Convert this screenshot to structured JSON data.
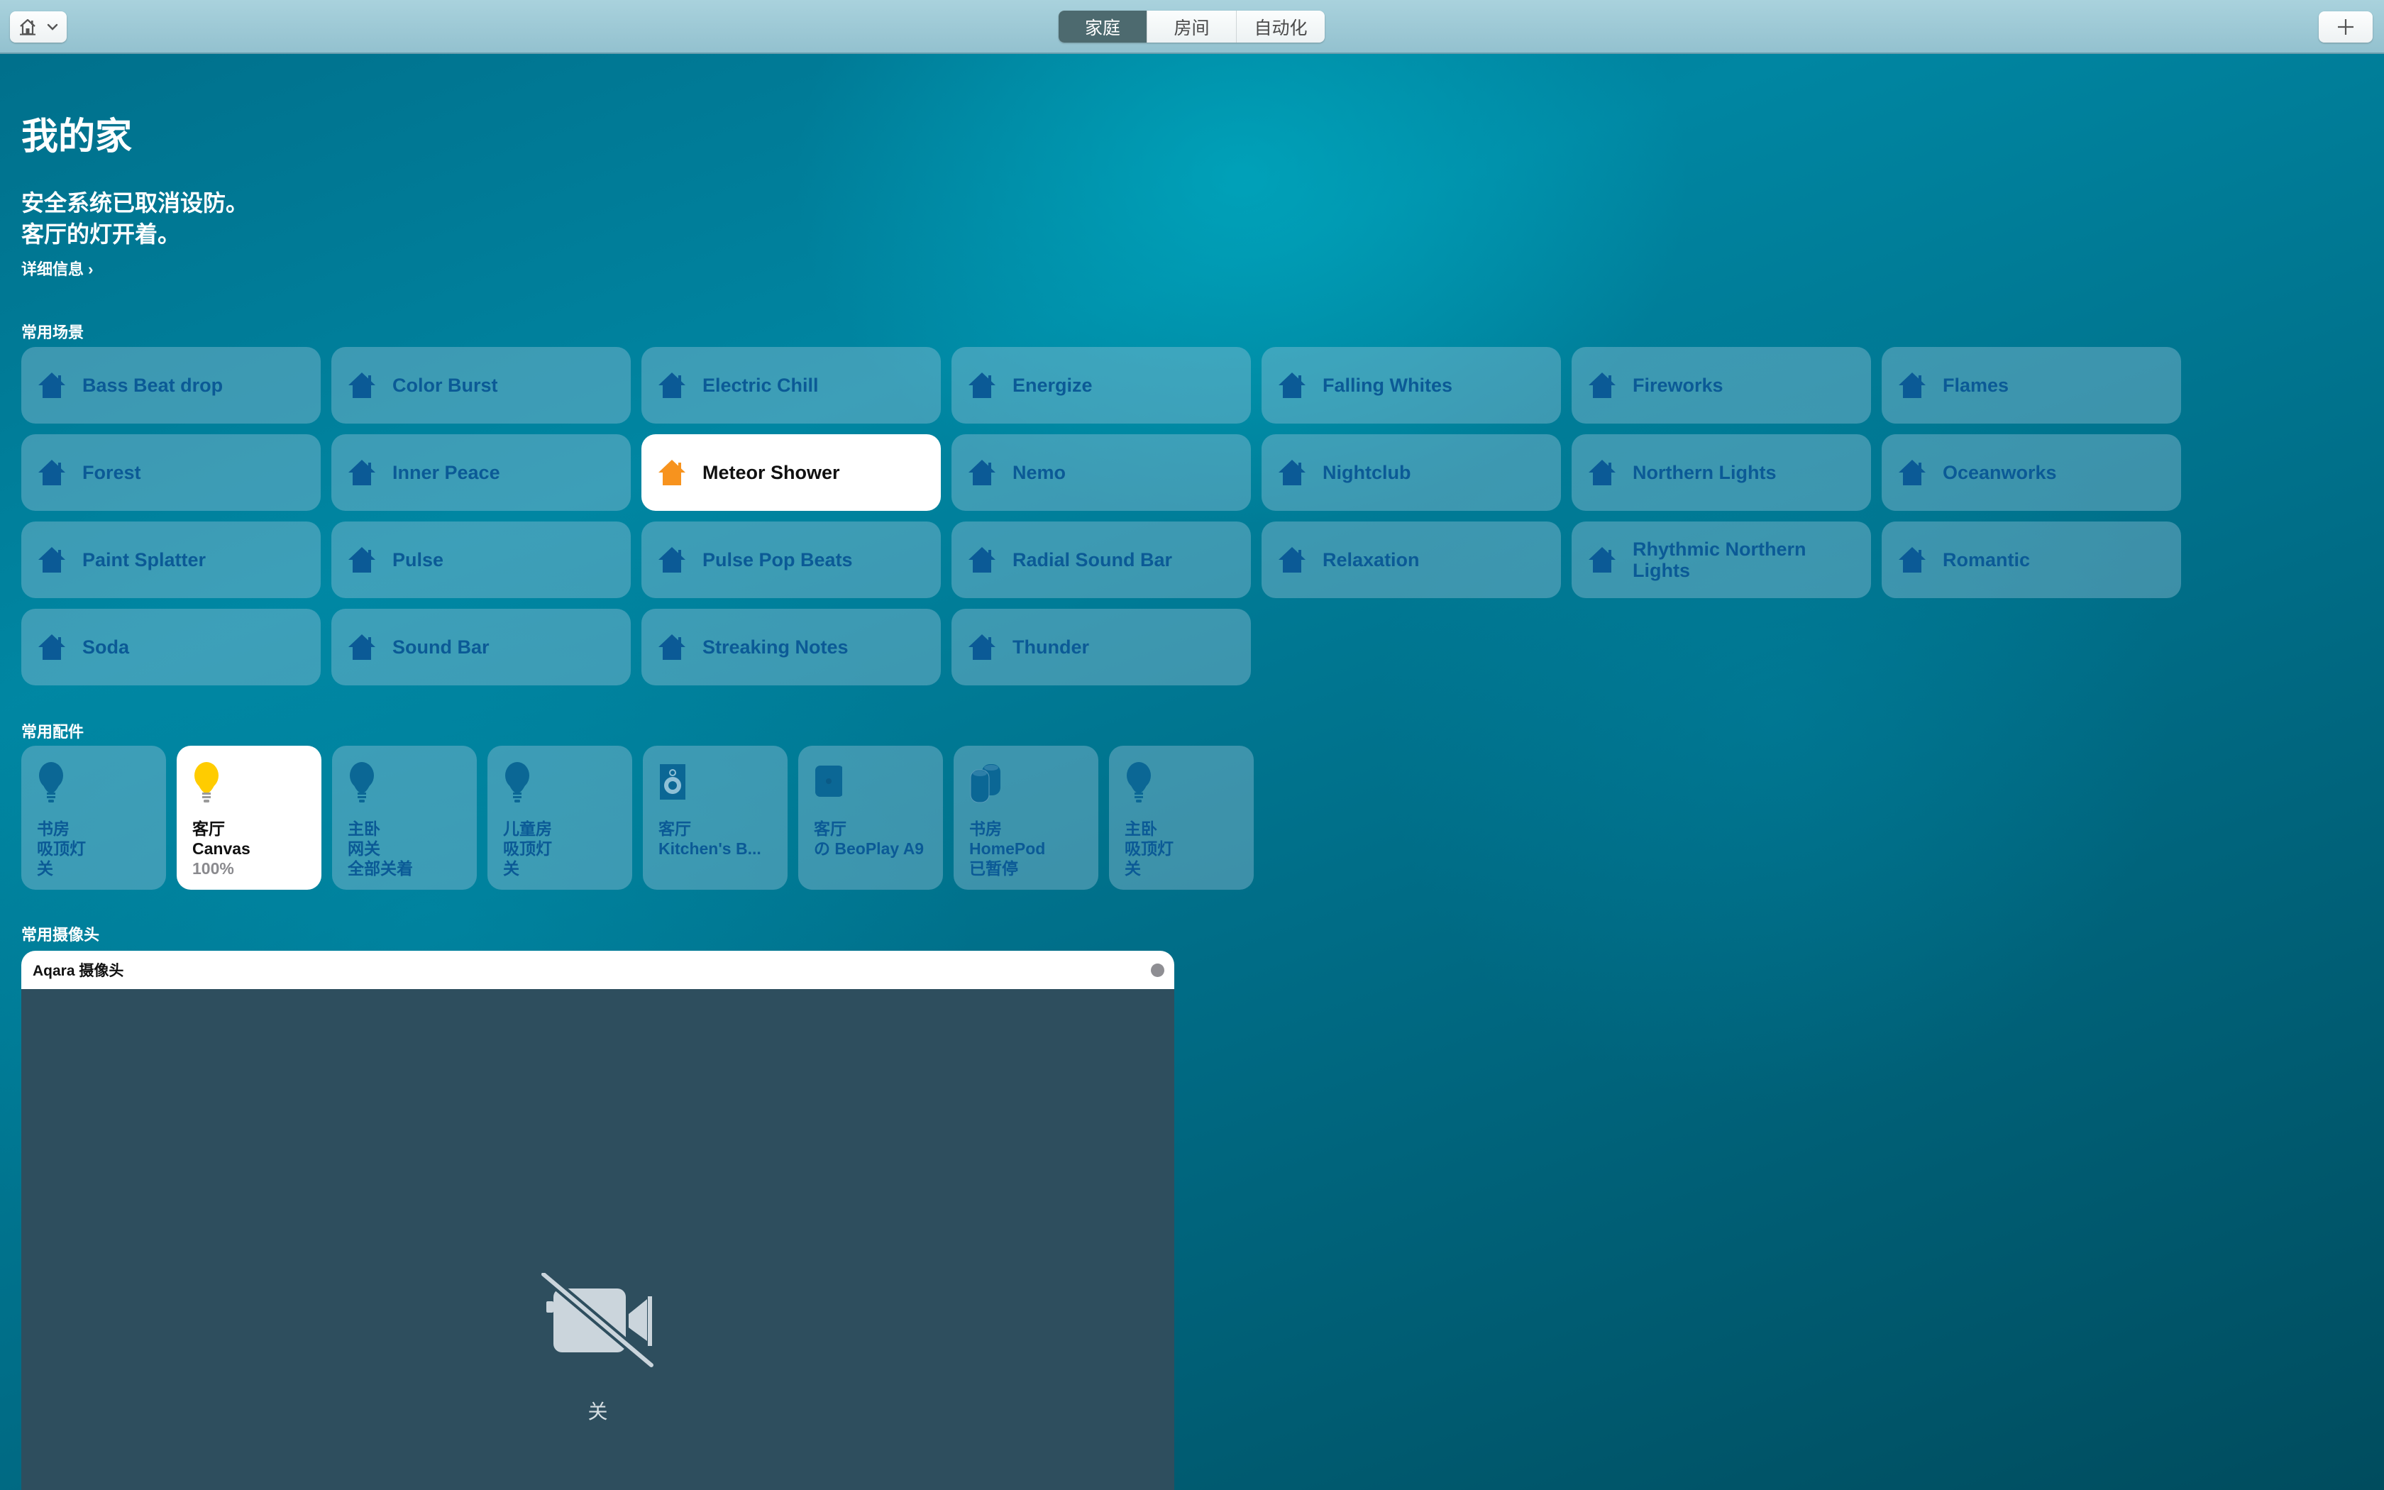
{
  "toolbar": {
    "home_menu_icon": "house-icon",
    "home_menu_chevron": "chevron-down-icon",
    "tabs": [
      {
        "label": "家庭",
        "active": true
      },
      {
        "label": "房间",
        "active": false
      },
      {
        "label": "自动化",
        "active": false
      }
    ],
    "add_icon": "plus-icon"
  },
  "header": {
    "title": "我的家",
    "status_lines": [
      "安全系统已取消设防。",
      "客厅的灯开着。"
    ],
    "details_link": "详细信息 ›"
  },
  "scenes": {
    "section_label": "常用场景",
    "items": [
      {
        "label": "Bass Beat drop",
        "on": false
      },
      {
        "label": "Color Burst",
        "on": false
      },
      {
        "label": "Electric Chill",
        "on": false
      },
      {
        "label": "Energize",
        "on": false
      },
      {
        "label": "Falling Whites",
        "on": false
      },
      {
        "label": "Fireworks",
        "on": false
      },
      {
        "label": "Flames",
        "on": false
      },
      {
        "label": "Forest",
        "on": false
      },
      {
        "label": "Inner Peace",
        "on": false
      },
      {
        "label": "Meteor Shower",
        "on": true
      },
      {
        "label": "Nemo",
        "on": false
      },
      {
        "label": "Nightclub",
        "on": false
      },
      {
        "label": "Northern Lights",
        "on": false
      },
      {
        "label": "Oceanworks",
        "on": false
      },
      {
        "label": "Paint Splatter",
        "on": false
      },
      {
        "label": "Pulse",
        "on": false
      },
      {
        "label": "Pulse Pop Beats",
        "on": false
      },
      {
        "label": "Radial Sound Bar",
        "on": false
      },
      {
        "label": "Relaxation",
        "on": false
      },
      {
        "label": "Rhythmic Northern Lights",
        "on": false
      },
      {
        "label": "Romantic",
        "on": false
      },
      {
        "label": "Soda",
        "on": false
      },
      {
        "label": "Sound Bar",
        "on": false
      },
      {
        "label": "Streaking Notes",
        "on": false
      },
      {
        "label": "Thunder",
        "on": false
      }
    ]
  },
  "accessories": {
    "section_label": "常用配件",
    "items": [
      {
        "room": "书房",
        "name": "吸顶灯",
        "status": "关",
        "icon": "lightbulb-icon",
        "on": false
      },
      {
        "room": "客厅",
        "name": "Canvas",
        "status": "100%",
        "icon": "lightbulb-icon",
        "on": true
      },
      {
        "room": "主卧",
        "name": "网关",
        "status": "全部关着",
        "icon": "lightbulb-icon",
        "on": false
      },
      {
        "room": "儿童房",
        "name": "吸顶灯",
        "status": "关",
        "icon": "lightbulb-icon",
        "on": false
      },
      {
        "room": "客厅",
        "name": "Kitchen's B...",
        "status": "",
        "icon": "speaker-icon",
        "on": false
      },
      {
        "room": "客厅",
        "name": "の BeoPlay A9",
        "status": "",
        "icon": "apple-tv-icon",
        "on": false
      },
      {
        "room": "书房",
        "name": "HomePod",
        "status": "已暂停",
        "icon": "homepod-icon",
        "on": false
      },
      {
        "room": "主卧",
        "name": "吸顶灯",
        "status": "关",
        "icon": "lightbulb-icon",
        "on": false
      }
    ]
  },
  "cameras": {
    "section_label": "常用摄像头",
    "items": [
      {
        "name": "Aqara 摄像头",
        "status": "关",
        "icon": "video-off-icon"
      }
    ]
  },
  "colors": {
    "scene_on_icon": "#f7931e",
    "scene_off_icon": "#0b5a96",
    "bulb_on": "#ffcc00",
    "active_tab": "#4d6a6f"
  }
}
